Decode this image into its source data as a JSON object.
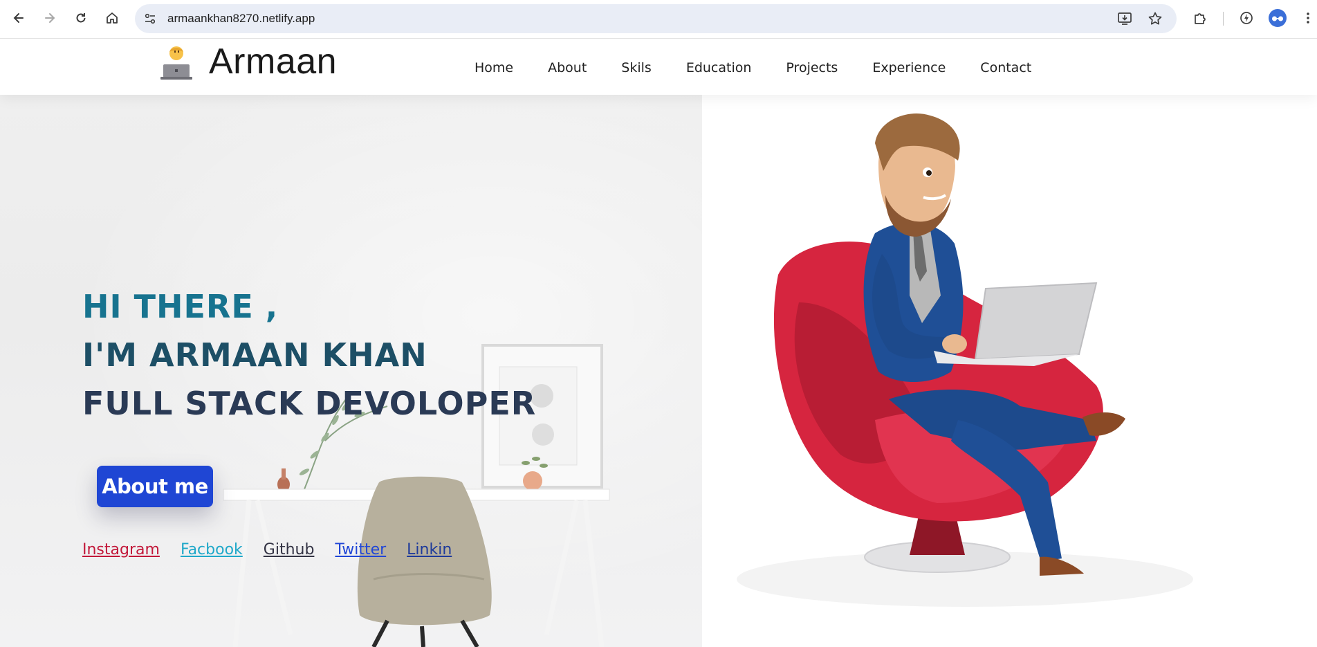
{
  "browser": {
    "url": "armaankhan8270.netlify.app"
  },
  "site": {
    "brand": "Armaan",
    "nav": [
      "Home",
      "About",
      "Skils",
      "Education",
      "Projects",
      "Experience",
      "Contact"
    ]
  },
  "hero": {
    "line1": "HI THERE ,",
    "line2": "I'M ARMAAN KHAN",
    "line3": "FULL STACK DEVOLOPER",
    "button": "About me",
    "socials": [
      {
        "label": "Instagram",
        "color": "#c2183a"
      },
      {
        "label": "Facbook",
        "color": "#1fa8c9"
      },
      {
        "label": "Github",
        "color": "#333344"
      },
      {
        "label": "Twitter",
        "color": "#2046d6"
      },
      {
        "label": "Linkin",
        "color": "#1e3a9a"
      }
    ]
  },
  "colors": {
    "accent": "#1f46d4",
    "heading": "#17738f"
  }
}
